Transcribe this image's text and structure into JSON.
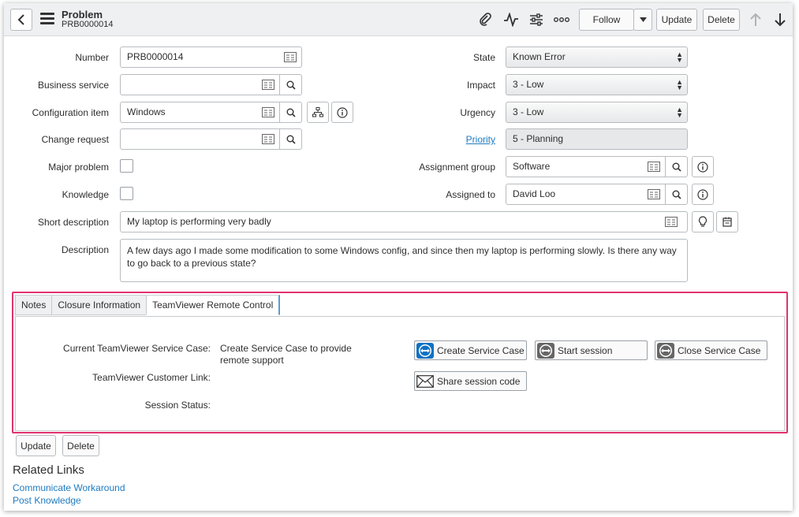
{
  "header": {
    "title": "Problem",
    "number": "PRB0000014",
    "follow_label": "Follow",
    "update_label": "Update",
    "delete_label": "Delete"
  },
  "form": {
    "number": {
      "label": "Number",
      "value": "PRB0000014"
    },
    "business_service": {
      "label": "Business service",
      "value": ""
    },
    "configuration_item": {
      "label": "Configuration item",
      "value": "Windows"
    },
    "change_request": {
      "label": "Change request",
      "value": ""
    },
    "major_problem": {
      "label": "Major problem"
    },
    "knowledge": {
      "label": "Knowledge"
    },
    "state": {
      "label": "State",
      "value": "Known Error"
    },
    "impact": {
      "label": "Impact",
      "value": "3 - Low"
    },
    "urgency": {
      "label": "Urgency",
      "value": "3 - Low"
    },
    "priority": {
      "label": "Priority",
      "value": "5 - Planning"
    },
    "assignment_group": {
      "label": "Assignment group",
      "value": "Software"
    },
    "assigned_to": {
      "label": "Assigned to",
      "value": "David Loo"
    },
    "short_description": {
      "label": "Short description",
      "value": "My laptop is performing very badly"
    },
    "description": {
      "label": "Description",
      "value": "A few days ago I made some modification to some Windows config, and since then my laptop is performing slowly. Is there any way to go back to a previous state?"
    }
  },
  "tabs": [
    {
      "label": "Notes"
    },
    {
      "label": "Closure Information"
    },
    {
      "label": "TeamViewer Remote Control"
    }
  ],
  "teamviewer": {
    "service_case_label": "Current TeamViewer Service Case:",
    "service_case_value": "Create Service Case to provide remote support",
    "customer_link_label": "TeamViewer Customer Link:",
    "session_status_label": "Session Status:",
    "create_case_label": "Create Service Case",
    "start_session_label": "Start session",
    "close_case_label": "Close Service Case",
    "share_code_label": "Share session code"
  },
  "bottom": {
    "update_label": "Update",
    "delete_label": "Delete"
  },
  "related_links": {
    "title": "Related Links",
    "items": [
      "Communicate Workaround",
      "Post Knowledge"
    ]
  },
  "colors": {
    "highlight": "#e0326e",
    "link": "#1f7bc1",
    "teamviewer_blue": "#0e72c4"
  }
}
